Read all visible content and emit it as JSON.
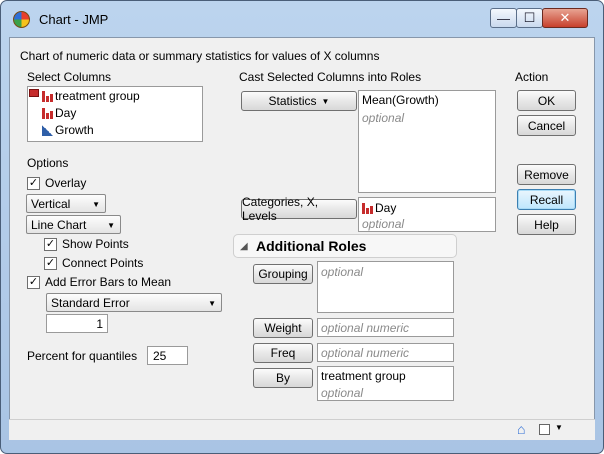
{
  "window": {
    "title": "Chart - JMP",
    "min_symbol": "—",
    "max_symbol": "☐",
    "close_symbol": "✕"
  },
  "description": "Chart of numeric data or summary statistics for values of X columns",
  "select_columns": {
    "label": "Select Columns",
    "items": [
      {
        "name": "treatment group",
        "icon": "nominal-icon"
      },
      {
        "name": "Day",
        "icon": "nominal-icon"
      },
      {
        "name": "Growth",
        "icon": "continuous-icon"
      }
    ]
  },
  "options": {
    "label": "Options",
    "overlay": {
      "label": "Overlay",
      "checked": true
    },
    "orientation": "Vertical",
    "chart_type": "Line Chart",
    "show_points": {
      "label": "Show Points",
      "checked": true
    },
    "connect_points": {
      "label": "Connect Points",
      "checked": true
    },
    "error_bars": {
      "label": "Add Error Bars to Mean",
      "checked": true
    },
    "error_type": "Standard Error",
    "error_multiplier": "1",
    "quantiles_label": "Percent for quantiles",
    "quantiles_value": "25"
  },
  "cast": {
    "label": "Cast Selected Columns into Roles",
    "statistics_button": "Statistics",
    "statistics_value": "Mean(Growth)",
    "optional": "optional",
    "categories_button": "Categories, X, Levels",
    "categories_value": "Day",
    "additional_roles": "Additional Roles",
    "grouping_button": "Grouping",
    "weight_button": "Weight",
    "freq_button": "Freq",
    "by_button": "By",
    "optional_numeric": "optional numeric",
    "by_value": "treatment group"
  },
  "action": {
    "label": "Action",
    "ok": "OK",
    "cancel": "Cancel",
    "remove": "Remove",
    "recall": "Recall",
    "help": "Help"
  },
  "symbols": {
    "check": "✓",
    "dropdown": "▼",
    "disclosure": "◢",
    "home": "⌂"
  }
}
